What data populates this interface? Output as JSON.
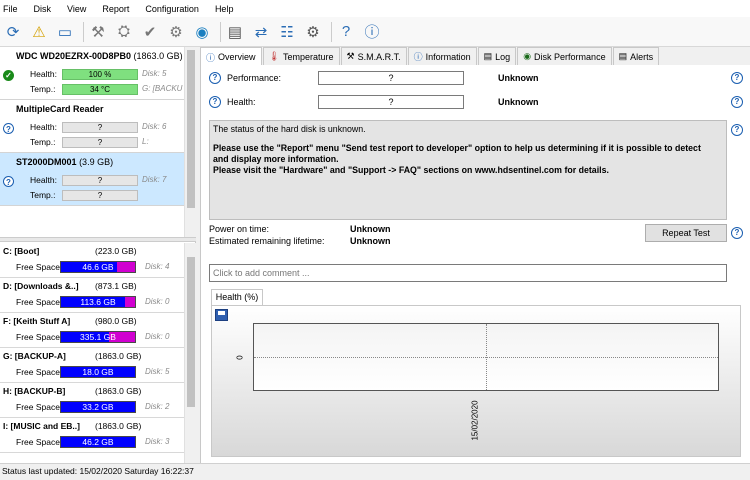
{
  "menu": [
    "File",
    "Disk",
    "View",
    "Report",
    "Configuration",
    "Help"
  ],
  "disks": [
    {
      "name": "WDC WD20EZRX-00D8PB0",
      "size": "(1863.0 GB)",
      "health_label": "Health:",
      "health": "100 %",
      "temp_label": "Temp.:",
      "temp": "34 °C",
      "disk": "Disk: 5",
      "letters": "G: [BACKU",
      "status": "ok"
    },
    {
      "name": "MultipleCard  Reader",
      "size": "",
      "health_label": "Health:",
      "health": "?",
      "temp_label": "Temp.:",
      "temp": "?",
      "disk": "Disk: 6",
      "letters": "L:",
      "status": "unknown"
    },
    {
      "name": "ST2000DM001",
      "size": "(3.9 GB)",
      "health_label": "Health:",
      "health": "?",
      "temp_label": "Temp.:",
      "temp": "?",
      "disk": "Disk: 7",
      "letters": "",
      "status": "unknown"
    }
  ],
  "partitions": [
    {
      "name": "C: [Boot]",
      "size": "(223.0 GB)",
      "free_label": "Free Space",
      "free": "46.6 GB",
      "disk": "Disk: 4"
    },
    {
      "name": "D: [Downloads &..]",
      "size": "(873.1 GB)",
      "free_label": "Free Space",
      "free": "113.6 GB",
      "disk": "Disk: 0"
    },
    {
      "name": "F: [Keith Stuff A]",
      "size": "(980.0 GB)",
      "free_label": "Free Space",
      "free": "335.1 GB",
      "disk": "Disk: 0"
    },
    {
      "name": "G: [BACKUP-A]",
      "size": "(1863.0 GB)",
      "free_label": "Free Space",
      "free": "18.0 GB",
      "disk": "Disk: 5"
    },
    {
      "name": "H: [BACKUP-B]",
      "size": "(1863.0 GB)",
      "free_label": "Free Space",
      "free": "33.2 GB",
      "disk": "Disk: 2"
    },
    {
      "name": "I: [MUSIC and EB..]",
      "size": "(1863.0 GB)",
      "free_label": "Free Space",
      "free": "46.2 GB",
      "disk": "Disk: 3"
    }
  ],
  "tabs": [
    "Overview",
    "Temperature",
    "S.M.A.R.T.",
    "Information",
    "Log",
    "Disk Performance",
    "Alerts"
  ],
  "overview": {
    "performance_label": "Performance:",
    "performance_value": "?",
    "performance_status": "Unknown",
    "health_label": "Health:",
    "health_value": "?",
    "health_status": "Unknown",
    "message": {
      "line1": "The status of the hard disk is unknown.",
      "line2": "Please use the \"Report\" menu \"Send test report to developer\" option to help us determining if it is possible to detect",
      "line3": "and display more information.",
      "line4": "Please visit the \"Hardware\" and \"Support -> FAQ\" sections on www.hdsentinel.com for details."
    },
    "power_on_label": "Power on time:",
    "power_on_value": "Unknown",
    "remaining_label": "Estimated remaining lifetime:",
    "remaining_value": "Unknown",
    "repeat_test": "Repeat Test",
    "comment_placeholder": "Click to add comment ...",
    "health_tab": "Health (%)"
  },
  "chart_data": {
    "type": "line",
    "title": "Health (%)",
    "x": [
      "15/02/2020"
    ],
    "series": [],
    "y_tick": "0",
    "grid": true
  },
  "status": "Status last updated: 15/02/2020 Saturday 16:22:37"
}
